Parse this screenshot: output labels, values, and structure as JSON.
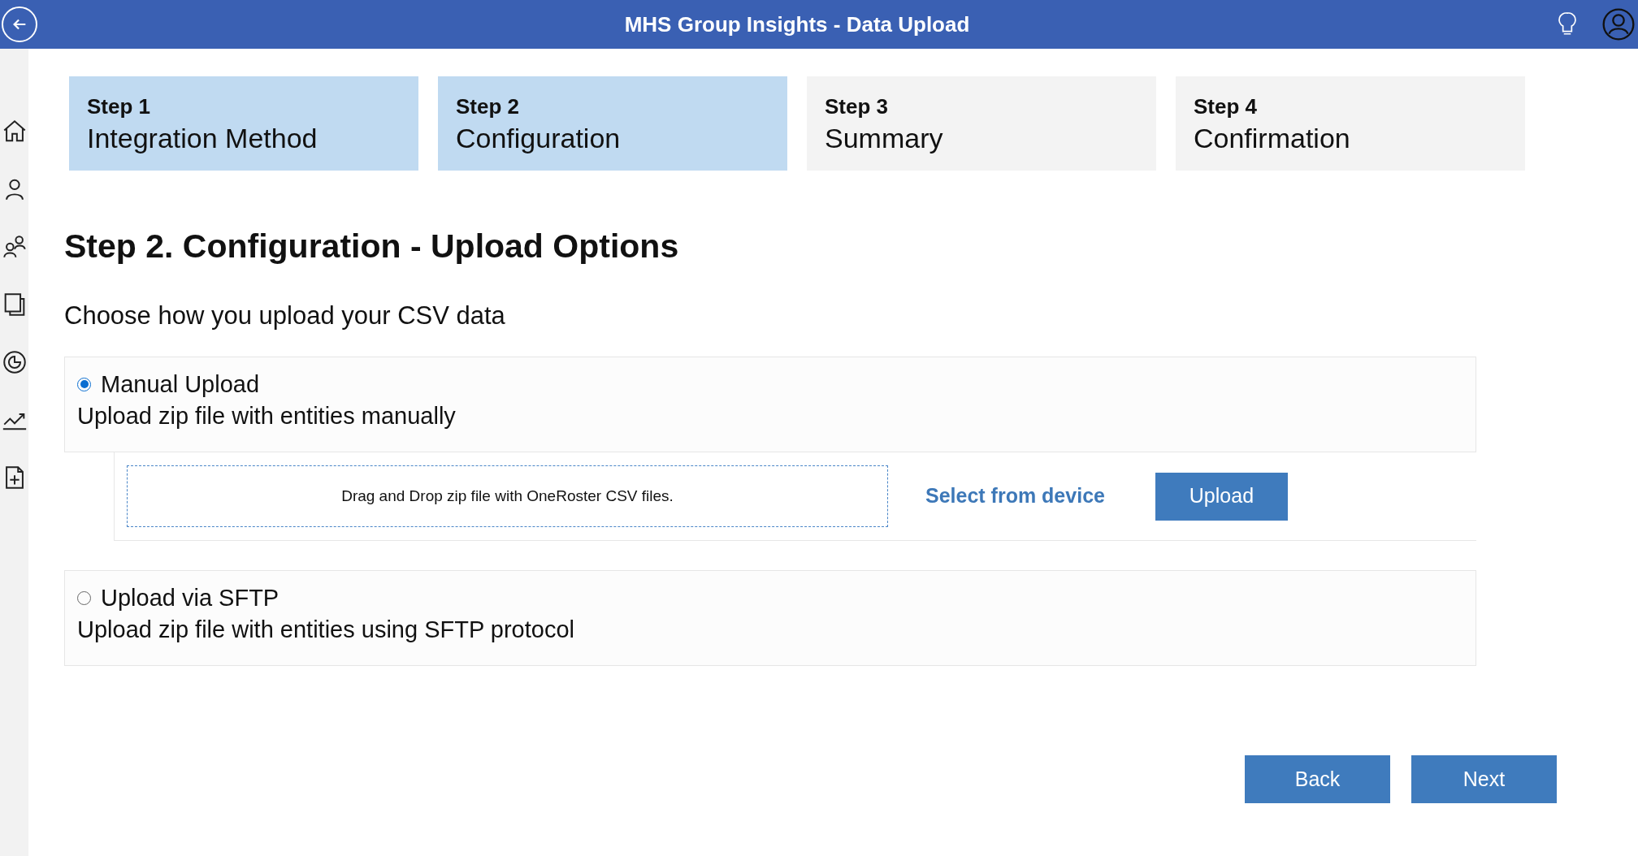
{
  "header": {
    "title": "MHS Group Insights - Data Upload"
  },
  "sidebar": {
    "items": [
      {
        "kind": "home"
      },
      {
        "kind": "person"
      },
      {
        "kind": "people"
      },
      {
        "kind": "pages"
      },
      {
        "kind": "target"
      },
      {
        "kind": "trend"
      },
      {
        "kind": "add-file"
      }
    ]
  },
  "steps": [
    {
      "number": "Step 1",
      "label": "Integration Method",
      "highlighted": true
    },
    {
      "number": "Step 2",
      "label": "Configuration",
      "highlighted": true
    },
    {
      "number": "Step 3",
      "label": "Summary",
      "highlighted": false
    },
    {
      "number": "Step 4",
      "label": "Confirmation",
      "highlighted": false
    }
  ],
  "heading": "Step 2. Configuration - Upload Options",
  "subheading": "Choose how you upload your CSV data",
  "options": [
    {
      "title": "Manual Upload",
      "description": "Upload zip file with entities manually",
      "selected": true,
      "upload": {
        "dropzone": "Drag and Drop zip file with OneRoster CSV files.",
        "link": "Select from device",
        "button": "Upload"
      }
    },
    {
      "title": "Upload via SFTP",
      "description": "Upload zip file with entities using SFTP protocol",
      "selected": false
    }
  ],
  "buttons": [
    "Back",
    "Next"
  ]
}
